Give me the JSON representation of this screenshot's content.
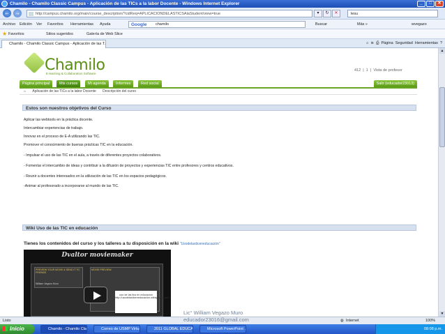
{
  "window": {
    "title": "Chamilo - Chamilo Classic Campus - Aplicación de las TICs a la labor Docente - Windows Internet Explorer"
  },
  "address": {
    "url": "http://campus.chamilo.org/main/course_description/?cidReq=APLICACIONDELASTICSAlaStudent/view=true"
  },
  "live_search": {
    "value": "lesu"
  },
  "menu": [
    "Archivo",
    "Edición",
    "Ver",
    "Favoritos",
    "Herramientas",
    "Ayuda"
  ],
  "google": {
    "label": "Google",
    "value": "chamilo"
  },
  "toolbar_right": {
    "buscar": "Buscar",
    "mas": "Más »",
    "user": "wvegazo"
  },
  "favorites": {
    "label": "Favoritos",
    "items": [
      "Sitios sugeridos",
      "Galería de Web Slice"
    ]
  },
  "tab": {
    "title": "Chamilo - Chamilo Classic Campus - Aplicación de las T..."
  },
  "tab_tools": {
    "pagina": "Página",
    "seguridad": "Seguridad",
    "herramientas": "Herramientas"
  },
  "site": {
    "brand": "Chamilo",
    "tagline": "E-learning & Collaboration Software",
    "counts": {
      "a": "412",
      "b": "1",
      "view": "Vista de profesor"
    },
    "nav": [
      "Página principal",
      "Mis cursos",
      "Mi agenda",
      "Informes",
      "Red social"
    ],
    "user": "Salir (educador23013)",
    "breadcrumbs": [
      "Aplicación de las TICs a la labor Docente",
      "Descripción del curso"
    ]
  },
  "objectives": {
    "heading": "Estos son nuestros objetivos del Curso",
    "lines": [
      "Aplicar las webtools en la práctica docente.",
      "Intercambiar experiencias de trabajo.",
      "Innovar en el proceso de E-A utilizando las TIC.",
      "Promover el conocimiento de buenas prácticas TIC en la educación.",
      "- Impulsar el uso de las TIC en el aula, a través de diferentes proyectos colaborativos.",
      "- Fomentar el intercambio de ideas y contribuir a la difusión de proyectos y experiencias TIC entre profesores y centros educativos.",
      "- Reunir a docentes interesados en la utilización de las TIC en los espacios pedagógicos.",
      "-Animar al profesorado a incorporarse al mundo de las TIC."
    ]
  },
  "wiki": {
    "heading": "Wiki Uso de las TIC en educación",
    "text": "Tienes los contenidos del curso y los talleres a tu disposición en la wiki",
    "link": "\"Usodelasticeneducación\""
  },
  "video": {
    "title": "Dvaltor moviemaker",
    "pane1": "PREVIEW YOUR MOVIE & SEND IT TO FRIENDS",
    "pane2": "MOVIE PREVIEW:",
    "card": "uso de las tics en educacion http://usodelasticeneducacion.wikispaces.com",
    "creator": "William Vegazo Muro"
  },
  "watermark": {
    "name": "Lic° William Vegazo Muro",
    "email": "educador23016@gmail.com"
  },
  "statusbar": {
    "left": "Listo",
    "zone": "Internet",
    "zoom": "100%"
  },
  "taskbar": {
    "start": "Inicio",
    "tasks": [
      "Chamilo - Chamilo Cla...",
      "Correo de USMP Virtu...",
      "2011 GLOBAL EDUCA...",
      "Microsoft PowerPoint ..."
    ],
    "clock": "08:08 p.m."
  }
}
